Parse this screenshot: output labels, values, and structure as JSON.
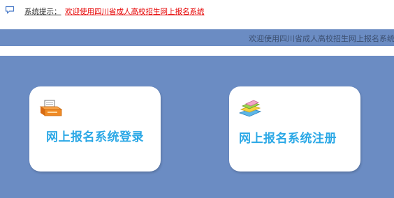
{
  "notice": {
    "icon": "speech-bubble-icon",
    "label": "系统提示：",
    "message": "欢迎使用四川省成人高校招生网上报名系统"
  },
  "marquee": {
    "text": "欢迎使用四川省成人高校招生网上报名系统"
  },
  "cards": {
    "login": {
      "label": "网上报名系统登录",
      "icon": "printer-icon"
    },
    "register": {
      "label": "网上报名系统注册",
      "icon": "books-icon"
    }
  },
  "colors": {
    "background_blue": "#6b8cc3",
    "card_text": "#2ba8e6",
    "notice_link": "#e60000"
  }
}
